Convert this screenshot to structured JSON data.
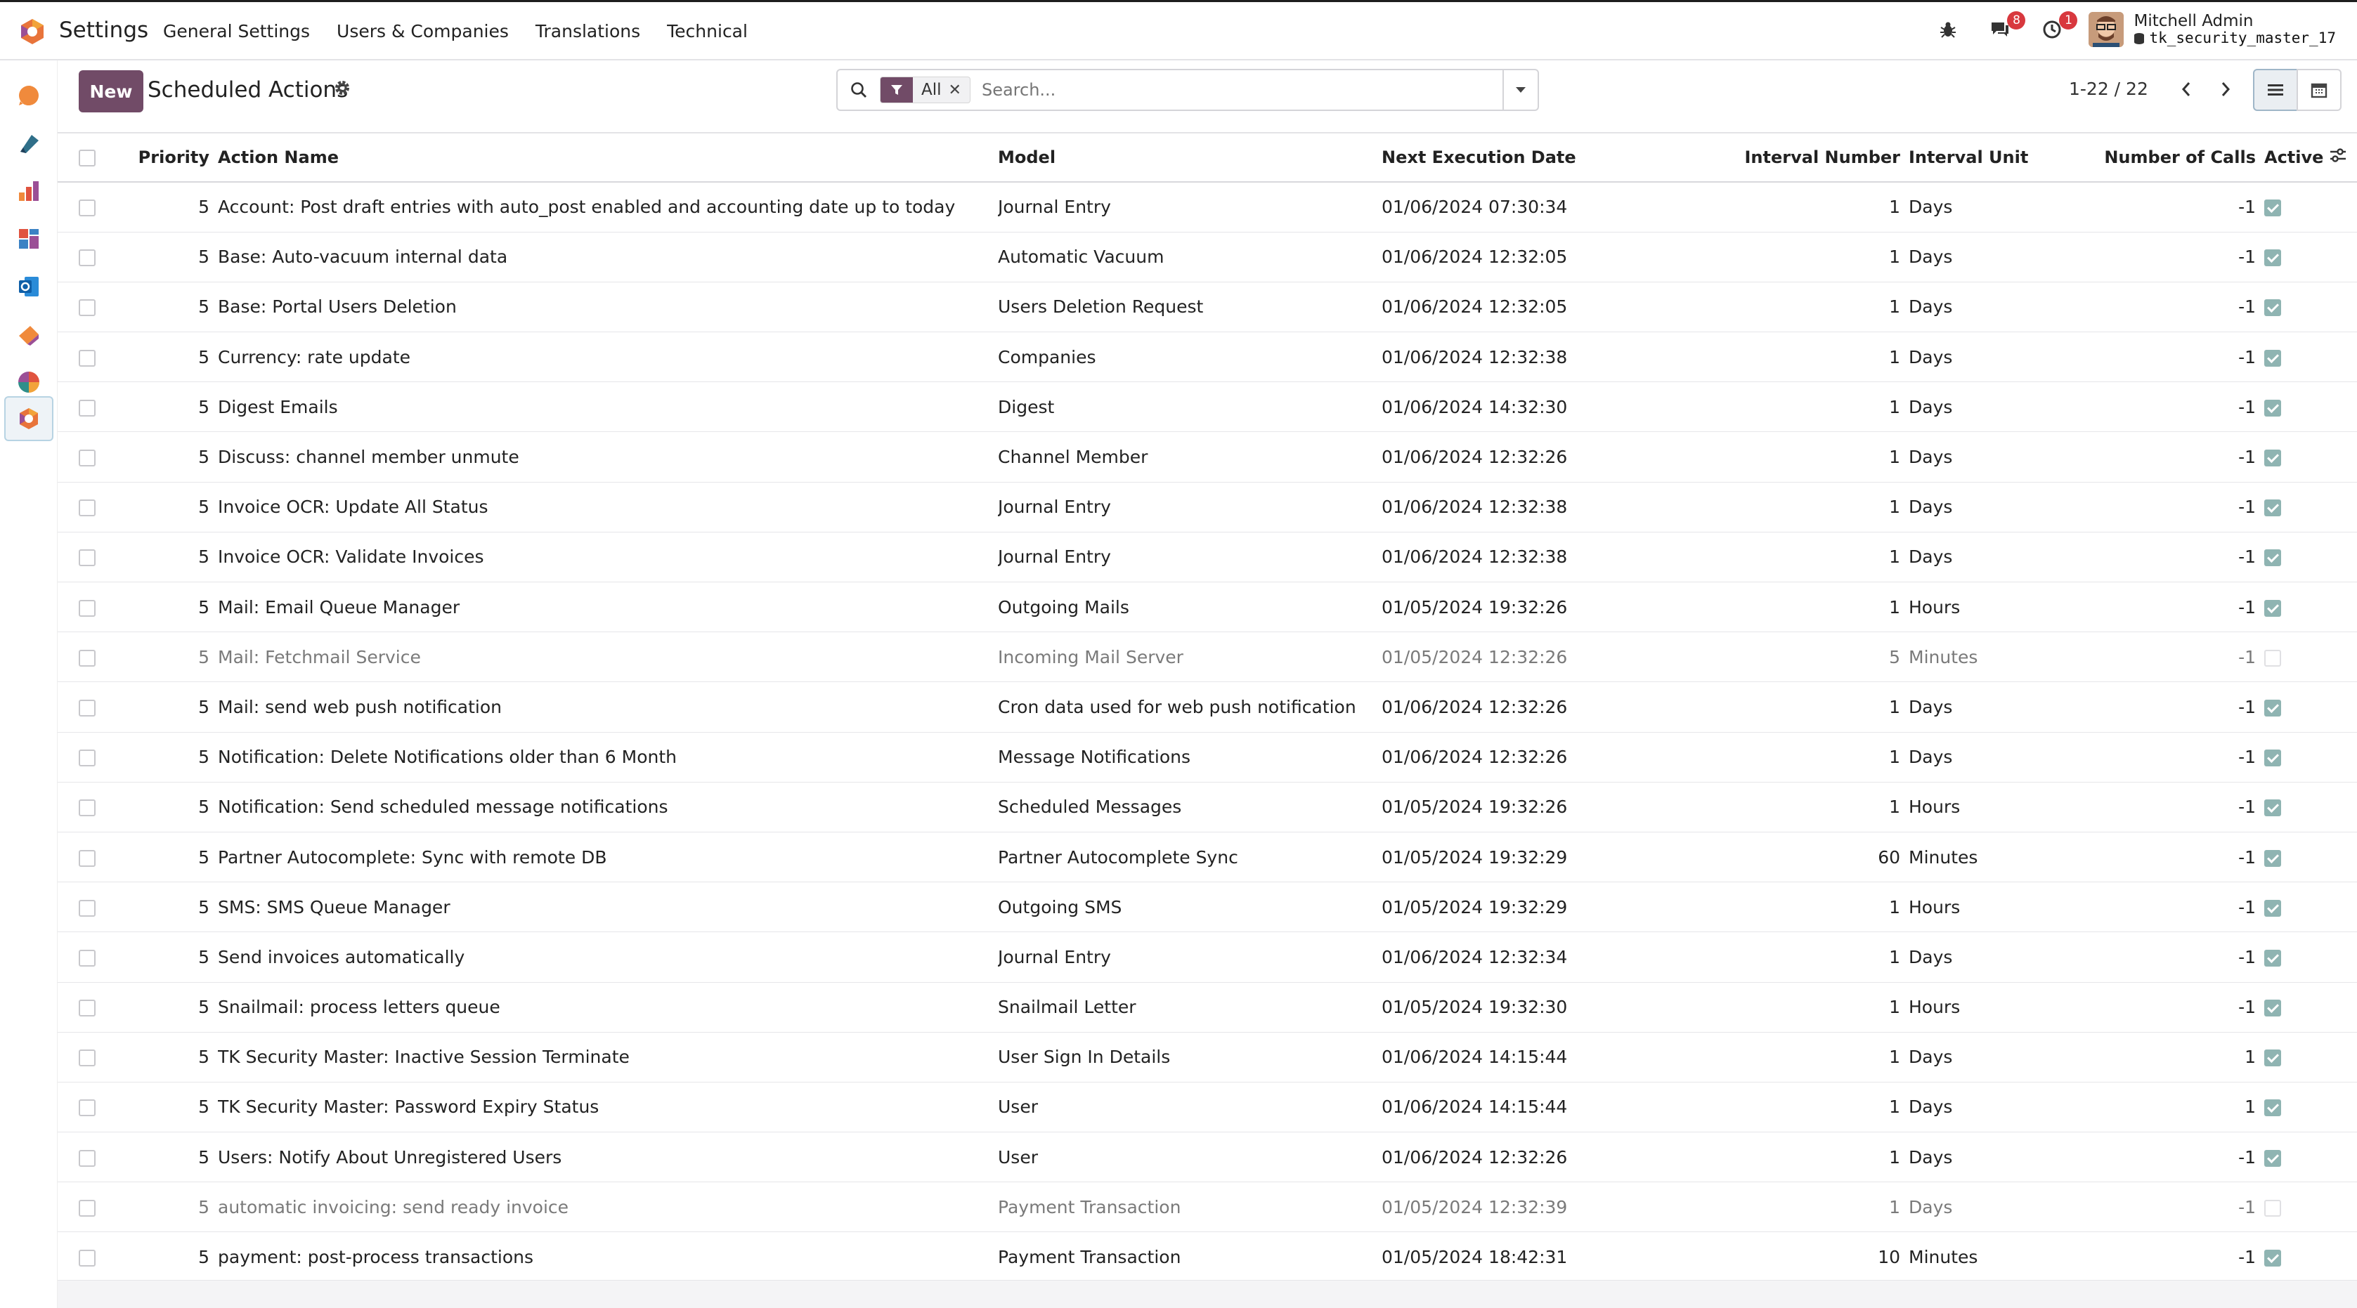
{
  "navbar": {
    "app_title": "Settings",
    "menu": [
      "General Settings",
      "Users & Companies",
      "Translations",
      "Technical"
    ],
    "messages_badge": "8",
    "activities_badge": "1",
    "user_name": "Mitchell Admin",
    "database": "tk_security_master_17"
  },
  "rail": {
    "apps": [
      "discuss",
      "sign",
      "reporting",
      "dashboards",
      "outlook",
      "apps",
      "accounting",
      "settings"
    ]
  },
  "control_panel": {
    "new_label": "New",
    "breadcrumb": "Scheduled Actions",
    "filter_facet": "All",
    "search_placeholder": "Search...",
    "pager": "1-22 / 22"
  },
  "table": {
    "columns": [
      "Priority",
      "Action Name",
      "Model",
      "Next Execution Date",
      "Interval Number",
      "Interval Unit",
      "Number of Calls",
      "Active"
    ],
    "rows": [
      {
        "priority": "5",
        "name": "Account: Post draft entries with auto_post enabled and accounting date up to today",
        "model": "Journal Entry",
        "next": "01/06/2024 07:30:34",
        "interval": "1",
        "unit": "Days",
        "calls": "-1",
        "active": true
      },
      {
        "priority": "5",
        "name": "Base: Auto-vacuum internal data",
        "model": "Automatic Vacuum",
        "next": "01/06/2024 12:32:05",
        "interval": "1",
        "unit": "Days",
        "calls": "-1",
        "active": true
      },
      {
        "priority": "5",
        "name": "Base: Portal Users Deletion",
        "model": "Users Deletion Request",
        "next": "01/06/2024 12:32:05",
        "interval": "1",
        "unit": "Days",
        "calls": "-1",
        "active": true
      },
      {
        "priority": "5",
        "name": "Currency: rate update",
        "model": "Companies",
        "next": "01/06/2024 12:32:38",
        "interval": "1",
        "unit": "Days",
        "calls": "-1",
        "active": true
      },
      {
        "priority": "5",
        "name": "Digest Emails",
        "model": "Digest",
        "next": "01/06/2024 14:32:30",
        "interval": "1",
        "unit": "Days",
        "calls": "-1",
        "active": true
      },
      {
        "priority": "5",
        "name": "Discuss: channel member unmute",
        "model": "Channel Member",
        "next": "01/06/2024 12:32:26",
        "interval": "1",
        "unit": "Days",
        "calls": "-1",
        "active": true
      },
      {
        "priority": "5",
        "name": "Invoice OCR: Update All Status",
        "model": "Journal Entry",
        "next": "01/06/2024 12:32:38",
        "interval": "1",
        "unit": "Days",
        "calls": "-1",
        "active": true
      },
      {
        "priority": "5",
        "name": "Invoice OCR: Validate Invoices",
        "model": "Journal Entry",
        "next": "01/06/2024 12:32:38",
        "interval": "1",
        "unit": "Days",
        "calls": "-1",
        "active": true
      },
      {
        "priority": "5",
        "name": "Mail: Email Queue Manager",
        "model": "Outgoing Mails",
        "next": "01/05/2024 19:32:26",
        "interval": "1",
        "unit": "Hours",
        "calls": "-1",
        "active": true
      },
      {
        "priority": "5",
        "name": "Mail: Fetchmail Service",
        "model": "Incoming Mail Server",
        "next": "01/05/2024 12:32:26",
        "interval": "5",
        "unit": "Minutes",
        "calls": "-1",
        "active": false
      },
      {
        "priority": "5",
        "name": "Mail: send web push notification",
        "model": "Cron data used for web push notification",
        "next": "01/06/2024 12:32:26",
        "interval": "1",
        "unit": "Days",
        "calls": "-1",
        "active": true
      },
      {
        "priority": "5",
        "name": "Notification: Delete Notifications older than 6 Month",
        "model": "Message Notifications",
        "next": "01/06/2024 12:32:26",
        "interval": "1",
        "unit": "Days",
        "calls": "-1",
        "active": true
      },
      {
        "priority": "5",
        "name": "Notification: Send scheduled message notifications",
        "model": "Scheduled Messages",
        "next": "01/05/2024 19:32:26",
        "interval": "1",
        "unit": "Hours",
        "calls": "-1",
        "active": true
      },
      {
        "priority": "5",
        "name": "Partner Autocomplete: Sync with remote DB",
        "model": "Partner Autocomplete Sync",
        "next": "01/05/2024 19:32:29",
        "interval": "60",
        "unit": "Minutes",
        "calls": "-1",
        "active": true
      },
      {
        "priority": "5",
        "name": "SMS: SMS Queue Manager",
        "model": "Outgoing SMS",
        "next": "01/05/2024 19:32:29",
        "interval": "1",
        "unit": "Hours",
        "calls": "-1",
        "active": true
      },
      {
        "priority": "5",
        "name": "Send invoices automatically",
        "model": "Journal Entry",
        "next": "01/06/2024 12:32:34",
        "interval": "1",
        "unit": "Days",
        "calls": "-1",
        "active": true
      },
      {
        "priority": "5",
        "name": "Snailmail: process letters queue",
        "model": "Snailmail Letter",
        "next": "01/05/2024 19:32:30",
        "interval": "1",
        "unit": "Hours",
        "calls": "-1",
        "active": true
      },
      {
        "priority": "5",
        "name": "TK Security Master: Inactive Session Terminate",
        "model": "User Sign In Details",
        "next": "01/06/2024 14:15:44",
        "interval": "1",
        "unit": "Days",
        "calls": "1",
        "active": true
      },
      {
        "priority": "5",
        "name": "TK Security Master: Password Expiry Status",
        "model": "User",
        "next": "01/06/2024 14:15:44",
        "interval": "1",
        "unit": "Days",
        "calls": "1",
        "active": true
      },
      {
        "priority": "5",
        "name": "Users: Notify About Unregistered Users",
        "model": "User",
        "next": "01/06/2024 12:32:26",
        "interval": "1",
        "unit": "Days",
        "calls": "-1",
        "active": true
      },
      {
        "priority": "5",
        "name": "automatic invoicing: send ready invoice",
        "model": "Payment Transaction",
        "next": "01/05/2024 12:32:39",
        "interval": "1",
        "unit": "Days",
        "calls": "-1",
        "active": false
      },
      {
        "priority": "5",
        "name": "payment: post-process transactions",
        "model": "Payment Transaction",
        "next": "01/05/2024 18:42:31",
        "interval": "10",
        "unit": "Minutes",
        "calls": "-1",
        "active": true
      }
    ]
  },
  "colors": {
    "brand": "#714b67",
    "active_check": "#8fb4b2",
    "badge": "#d8383e"
  }
}
